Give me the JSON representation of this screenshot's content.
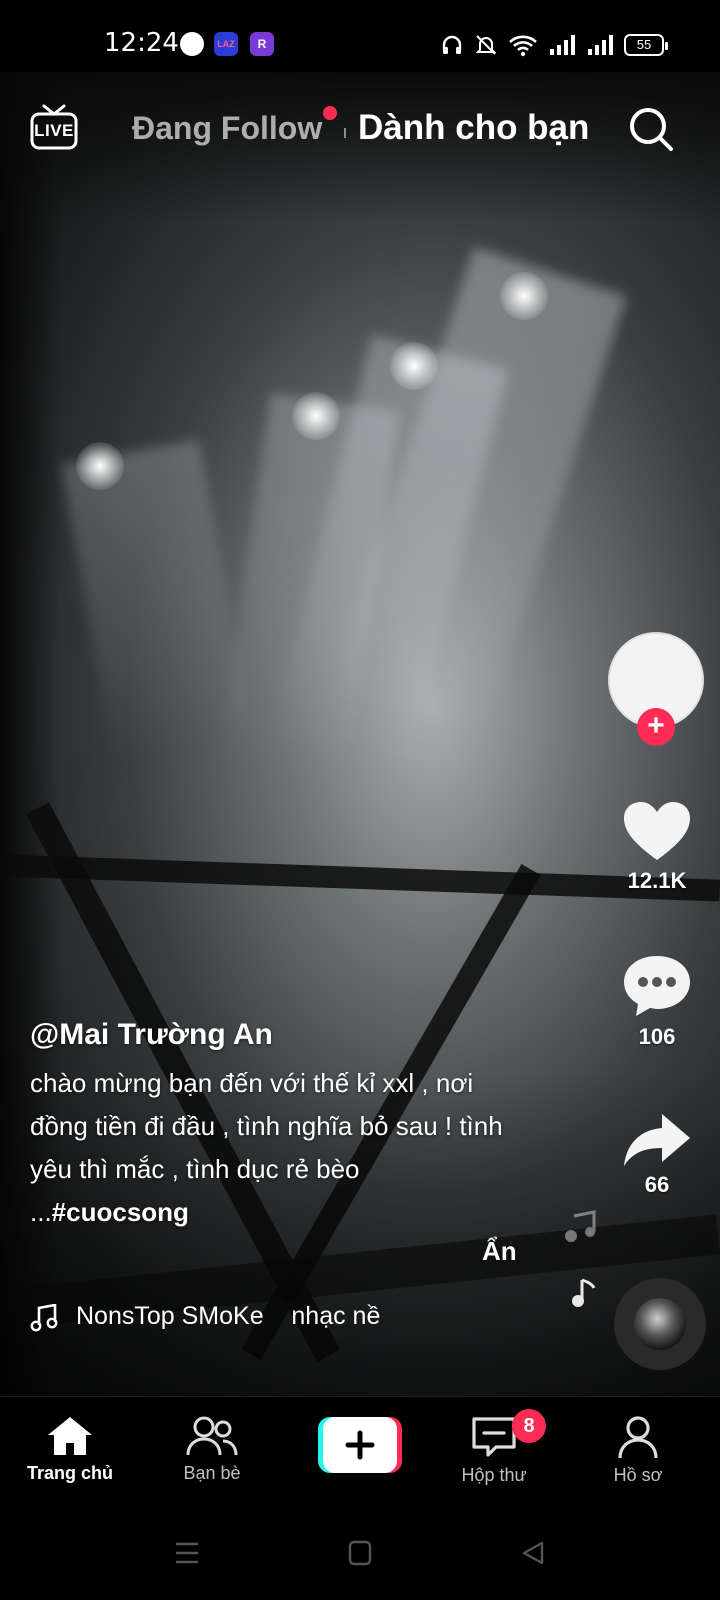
{
  "status_bar": {
    "time": "12:24",
    "app_icons": [
      "chrome-icon",
      "lazada-icon",
      "r-app-icon"
    ],
    "lazada_label": "LAZ",
    "r_label": "R",
    "battery": "55"
  },
  "top_bar": {
    "live_label": "LIVE",
    "tabs": [
      {
        "label": "Đang Follow",
        "active": false
      },
      {
        "label": "Dành cho bạn",
        "active": true
      }
    ]
  },
  "post": {
    "username": "@Mai Trường An",
    "caption": "chào mừng bạn đến với thế kỉ xxl , nơi đồng tiền đi đầu , tình nghĩa bỏ sau ! tình yêu thì mắc , tình dục rẻ bèo ...",
    "hashtag": "#cuocsong",
    "hide_label": "Ẩn",
    "music_text": "NonsTop SMoKe    nhạc nề"
  },
  "actions": {
    "likes": "12.1K",
    "comments": "106",
    "shares": "66"
  },
  "bottom_nav": {
    "items": [
      {
        "label": "Trang chủ",
        "icon": "home-icon",
        "active": true
      },
      {
        "label": "Bạn bè",
        "icon": "friends-icon",
        "active": false
      },
      {
        "label": "",
        "icon": "create-icon",
        "active": false
      },
      {
        "label": "Hộp thư",
        "icon": "inbox-icon",
        "active": false
      },
      {
        "label": "Hồ sơ",
        "icon": "profile-icon",
        "active": false
      }
    ],
    "inbox_badge": "8"
  },
  "colors": {
    "accent": "#fe2c55",
    "cyan": "#25f4ee"
  }
}
